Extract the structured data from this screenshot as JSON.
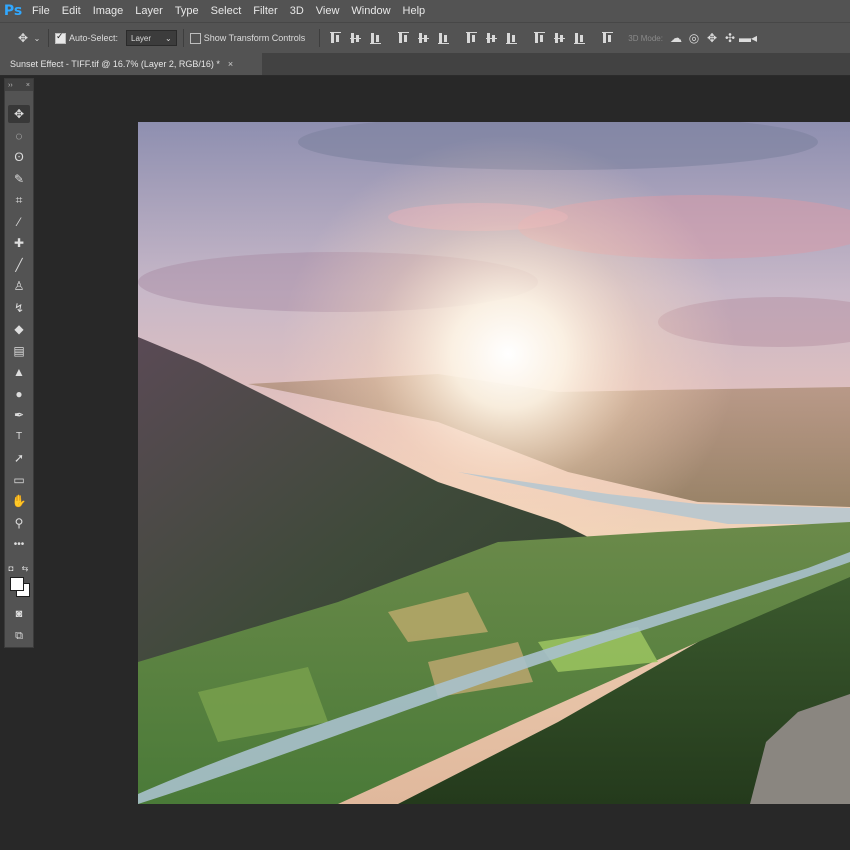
{
  "app": {
    "logo": "Ps"
  },
  "menu": [
    "File",
    "Edit",
    "Image",
    "Layer",
    "Type",
    "Select",
    "Filter",
    "3D",
    "View",
    "Window",
    "Help"
  ],
  "options": {
    "auto_select_label": "Auto-Select:",
    "auto_select_checked": true,
    "target_value": "Layer",
    "show_transform_label": "Show Transform Controls",
    "show_transform_checked": false,
    "mode_3d_label": "3D Mode:"
  },
  "document_tab": {
    "title": "Sunset Effect - TIFF.tif @ 16.7% (Layer 2, RGB/16) *",
    "close": "×"
  },
  "toolbar": {
    "header_collapse": "››",
    "header_close": "×",
    "tools": [
      {
        "name": "move-tool-icon",
        "glyph": "✥"
      },
      {
        "name": "marquee-tool-icon",
        "glyph": "◌"
      },
      {
        "name": "lasso-tool-icon",
        "glyph": "ʘ"
      },
      {
        "name": "quick-select-tool-icon",
        "glyph": "✎"
      },
      {
        "name": "crop-tool-icon",
        "glyph": "⌗"
      },
      {
        "name": "eyedropper-tool-icon",
        "glyph": "⁄"
      },
      {
        "name": "healing-brush-tool-icon",
        "glyph": "✚"
      },
      {
        "name": "brush-tool-icon",
        "glyph": "╱"
      },
      {
        "name": "clone-stamp-tool-icon",
        "glyph": "♙"
      },
      {
        "name": "history-brush-tool-icon",
        "glyph": "↯"
      },
      {
        "name": "eraser-tool-icon",
        "glyph": "◆"
      },
      {
        "name": "gradient-tool-icon",
        "glyph": "▤"
      },
      {
        "name": "blur-tool-icon",
        "glyph": "▲"
      },
      {
        "name": "dodge-tool-icon",
        "glyph": "●"
      },
      {
        "name": "pen-tool-icon",
        "glyph": "✒"
      },
      {
        "name": "type-tool-icon",
        "glyph": "T"
      },
      {
        "name": "path-select-tool-icon",
        "glyph": "➚"
      },
      {
        "name": "rectangle-tool-icon",
        "glyph": "▭"
      },
      {
        "name": "hand-tool-icon",
        "glyph": "✋"
      },
      {
        "name": "zoom-tool-icon",
        "glyph": "⚲"
      },
      {
        "name": "more-tools-icon",
        "glyph": "•••"
      }
    ],
    "default_colors_glyph": "◘",
    "swap_colors_glyph": "⇆",
    "foreground_color": "#ffffff",
    "background_color": "#ffffff",
    "quick_mask_glyph": "◙",
    "screen_mode_glyph": "⧉"
  },
  "colors": {
    "ps_blue": "#31a8ff",
    "panel": "#535353",
    "workspace": "#282828"
  }
}
